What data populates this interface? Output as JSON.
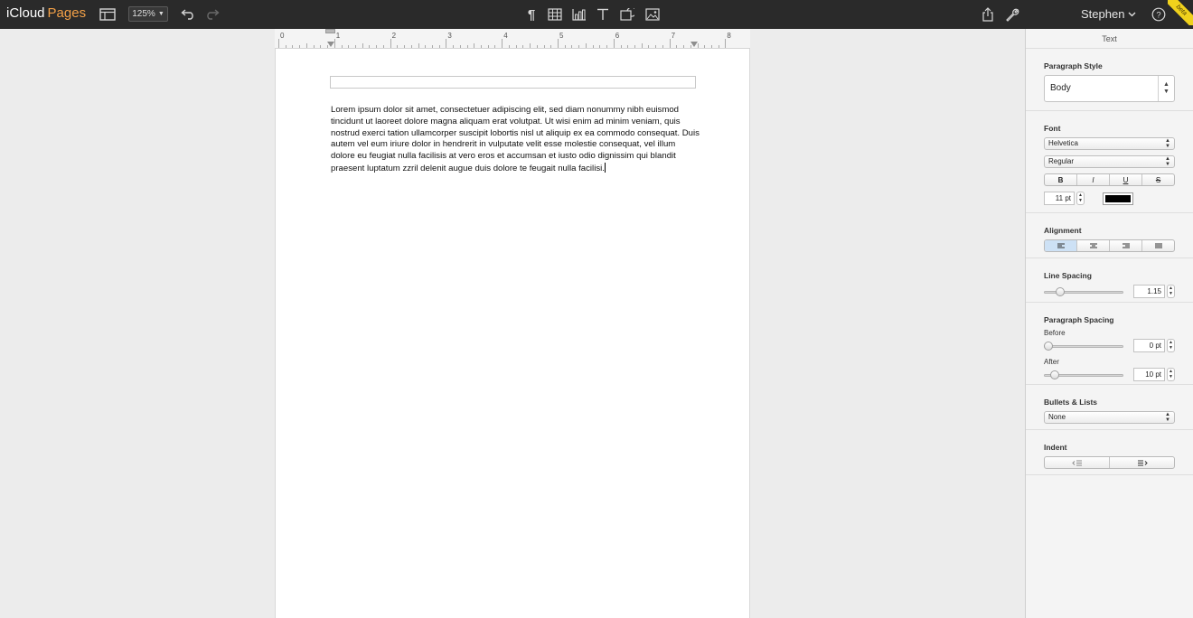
{
  "toolbar": {
    "brand_prefix": "iCloud",
    "brand_app": "Pages",
    "zoom_label": "125%",
    "user_name": "Stephen",
    "beta_label": "beta"
  },
  "ruler": {
    "numbers": [
      "0",
      "1",
      "2",
      "3",
      "4",
      "5",
      "6",
      "7",
      "8"
    ]
  },
  "document": {
    "body_text": "Lorem ipsum dolor sit amet, consectetuer adipiscing elit, sed diam nonummy nibh euismod tincidunt ut laoreet dolore magna aliquam erat volutpat. Ut wisi enim ad minim veniam, quis nostrud exerci tation ullamcorper suscipit lobortis nisl ut aliquip ex ea commodo consequat. Duis autem vel eum iriure dolor in hendrerit in vulputate velit esse molestie consequat, vel illum dolore eu feugiat nulla facilisis at vero eros et accumsan et iusto odio dignissim qui blandit praesent luptatum zzril delenit augue duis dolore te feugait nulla facilisi."
  },
  "sidebar": {
    "title": "Text",
    "paragraph_style": {
      "label": "Paragraph Style",
      "value": "Body"
    },
    "font": {
      "label": "Font",
      "family": "Helvetica",
      "typeface": "Regular",
      "bold": "B",
      "italic": "I",
      "underline": "U",
      "strike": "S",
      "size": "11 pt",
      "color": "#000000"
    },
    "alignment": {
      "label": "Alignment",
      "selected": "left"
    },
    "line_spacing": {
      "label": "Line Spacing",
      "value": "1.15"
    },
    "paragraph_spacing": {
      "label": "Paragraph Spacing",
      "before_label": "Before",
      "before_value": "0 pt",
      "after_label": "After",
      "after_value": "10 pt"
    },
    "bullets": {
      "label": "Bullets & Lists",
      "value": "None"
    },
    "indent": {
      "label": "Indent"
    }
  }
}
